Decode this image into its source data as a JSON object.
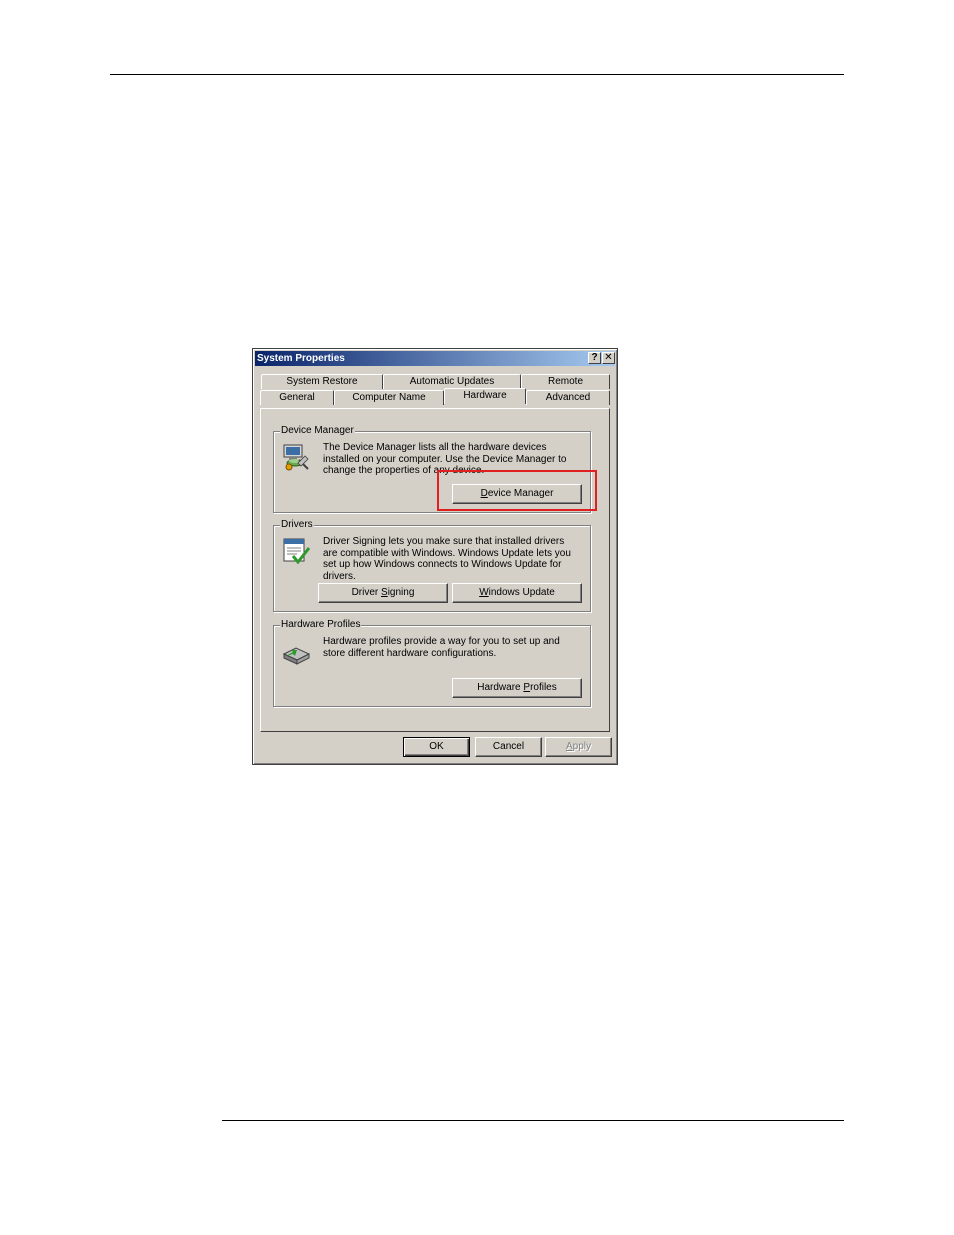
{
  "dialog": {
    "title": "System Properties",
    "help_label": "?",
    "close_label": "✕"
  },
  "tabs": {
    "row1": [
      "System Restore",
      "Automatic Updates",
      "Remote"
    ],
    "row2": [
      "General",
      "Computer Name",
      "Hardware",
      "Advanced"
    ],
    "active": "Hardware"
  },
  "device_manager": {
    "label": "Device Manager",
    "text": "The Device Manager lists all the hardware devices installed on your computer. Use the Device Manager to change the properties of any device.",
    "button_pre": "",
    "button_key": "D",
    "button_post": "evice Manager",
    "icon": "device-manager-icon"
  },
  "drivers": {
    "label": "Drivers",
    "text": "Driver Signing lets you make sure that installed drivers are compatible with Windows. Windows Update lets you set up how Windows connects to Windows Update for drivers.",
    "signing_pre": "Driver ",
    "signing_key": "S",
    "signing_post": "igning",
    "update_pre": "",
    "update_key": "W",
    "update_post": "indows Update",
    "icon": "driver-signing-icon"
  },
  "hardware_profiles": {
    "label": "Hardware Profiles",
    "text": "Hardware profiles provide a way for you to set up and store different hardware configurations.",
    "button_pre": "Hardware ",
    "button_key": "P",
    "button_post": "rofiles",
    "icon": "hardware-profiles-icon"
  },
  "footer": {
    "ok_label": "OK",
    "cancel_label": "Cancel",
    "apply_key": "A",
    "apply_post": "pply"
  },
  "colors": {
    "highlight": "#e02020",
    "title_start": "#0a246a",
    "title_end": "#a6caf0",
    "face": "#d4d0c8"
  }
}
